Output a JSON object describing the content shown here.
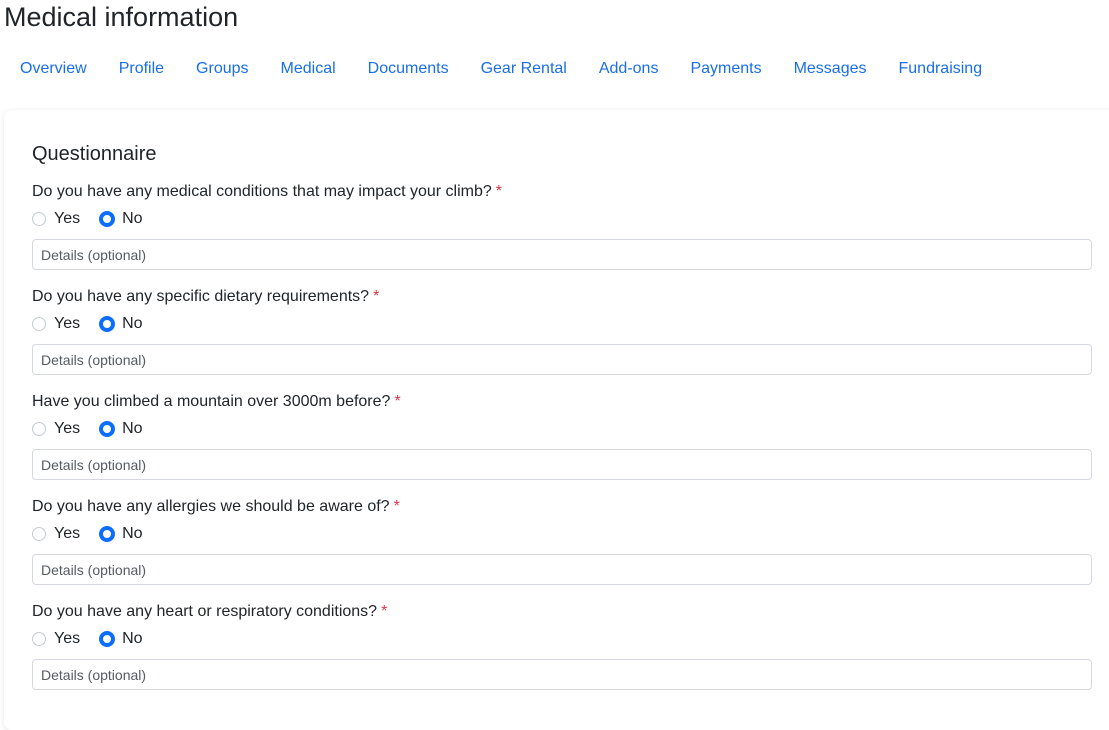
{
  "page": {
    "title": "Medical information"
  },
  "nav": {
    "items": [
      {
        "label": "Overview"
      },
      {
        "label": "Profile"
      },
      {
        "label": "Groups"
      },
      {
        "label": "Medical"
      },
      {
        "label": "Documents"
      },
      {
        "label": "Gear Rental"
      },
      {
        "label": "Add-ons"
      },
      {
        "label": "Payments"
      },
      {
        "label": "Messages"
      },
      {
        "label": "Fundraising"
      }
    ]
  },
  "questionnaire": {
    "title": "Questionnaire",
    "required_marker": "*",
    "yes_label": "Yes",
    "no_label": "No",
    "details_placeholder": "Details (optional)",
    "questions": [
      {
        "text": "Do you have any medical conditions that may impact your climb?",
        "selected": "No"
      },
      {
        "text": "Do you have any specific dietary requirements?",
        "selected": "No"
      },
      {
        "text": "Have you climbed a mountain over 3000m before?",
        "selected": "No"
      },
      {
        "text": "Do you have any allergies we should be aware of?",
        "selected": "No"
      },
      {
        "text": "Do you have any heart or respiratory conditions?",
        "selected": "No"
      }
    ]
  },
  "colors": {
    "link": "#1a6fe6",
    "radio_checked": "#0d6efd",
    "required": "#dc3545"
  }
}
